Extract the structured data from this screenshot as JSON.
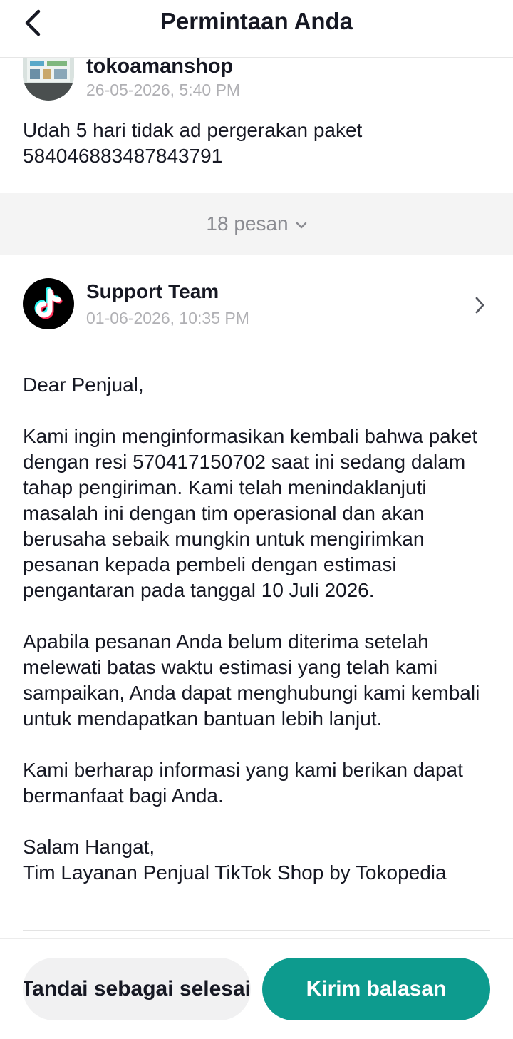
{
  "header": {
    "title": "Permintaan Anda"
  },
  "first_message": {
    "sender": "tokoamanshop",
    "timestamp": "26-05-2026, 5:40 PM",
    "body_line1": "Udah 5 hari tidak ad pergerakan paket",
    "body_line2": "584046883487843791"
  },
  "collapsed": {
    "label": "18 pesan"
  },
  "support_message": {
    "sender": "Support Team",
    "timestamp": "01-06-2026, 10:35 PM",
    "greeting": "Dear Penjual,",
    "paragraph1": "Kami ingin menginformasikan kembali bahwa paket dengan resi 570417150702 saat ini sedang dalam tahap pengiriman. Kami telah menindaklanjuti masalah ini dengan tim operasional dan akan berusaha sebaik mungkin untuk mengirimkan pesanan kepada pembeli dengan estimasi pengantaran pada tanggal 10 Juli 2026.",
    "paragraph2": "Apabila pesanan Anda belum diterima setelah melewati batas waktu estimasi yang telah kami sampaikan, Anda dapat menghubungi kami kembali untuk mendapatkan bantuan lebih lanjut.",
    "paragraph3": "Kami berharap informasi yang kami berikan dapat bermanfaat bagi Anda.",
    "closing": "Salam Hangat,",
    "signature": "Tim Layanan Penjual TikTok Shop by Tokopedia"
  },
  "footer": {
    "mark_done_label": "Tandai sebagai selesai",
    "reply_label": "Kirim balasan"
  },
  "colors": {
    "accent": "#0d9b8e",
    "muted_text": "#b0b0b4",
    "collapse_bg": "#f4f4f4"
  },
  "icons": {
    "back": "chevron-left-icon",
    "expand": "chevron-down-icon",
    "open": "chevron-right-icon",
    "support_avatar": "tiktok-logo-icon"
  }
}
